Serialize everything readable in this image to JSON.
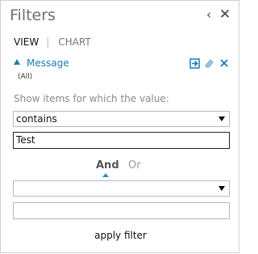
{
  "panel": {
    "title": "Filters",
    "collapse_icon": "chevron-left-icon",
    "close_icon": "close-icon"
  },
  "tabs": {
    "view": "VIEW",
    "chart": "CHART"
  },
  "field": {
    "name": "Message",
    "value": "(All)",
    "actions": [
      "apply-filter-icon",
      "eraser-icon",
      "remove-icon"
    ]
  },
  "filter": {
    "instruction": "Show items for which the value:",
    "condition1": "contains",
    "value1": "Test",
    "logic_and": "And",
    "logic_or": "Or",
    "condition2": "",
    "value2": "",
    "apply_label": "apply filter"
  },
  "colors": {
    "accent": "#1a7ab8",
    "logic_marker": "#2f8fce"
  }
}
